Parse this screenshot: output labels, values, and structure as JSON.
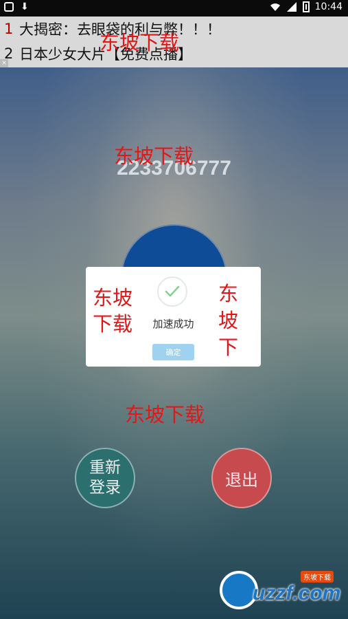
{
  "status_bar": {
    "time": "10:44"
  },
  "ads": [
    {
      "num": "1",
      "text": "大揭密：去眼袋的利与弊！！！"
    },
    {
      "num": "2",
      "text": "日本少女大片【免费点播】"
    }
  ],
  "account": "2233706777",
  "dialog": {
    "message": "加速成功",
    "confirm": "确定"
  },
  "buttons": {
    "relogin": "重新登录",
    "exit": "退出"
  },
  "watermarks": {
    "top": "东坡下载",
    "mid": "东坡下载",
    "bottom": "东坡下载",
    "dialog_left": "东坡下载",
    "dialog_right": "东坡下"
  },
  "logo": {
    "text": "uzzf.com",
    "tag": "东坡下载"
  },
  "colors": {
    "watermark": "#e01818",
    "boost_circle": "#0f4c97",
    "exit": "#c64a4e",
    "relogin": "#2c6f6f",
    "confirm": "#9fd2ef"
  }
}
